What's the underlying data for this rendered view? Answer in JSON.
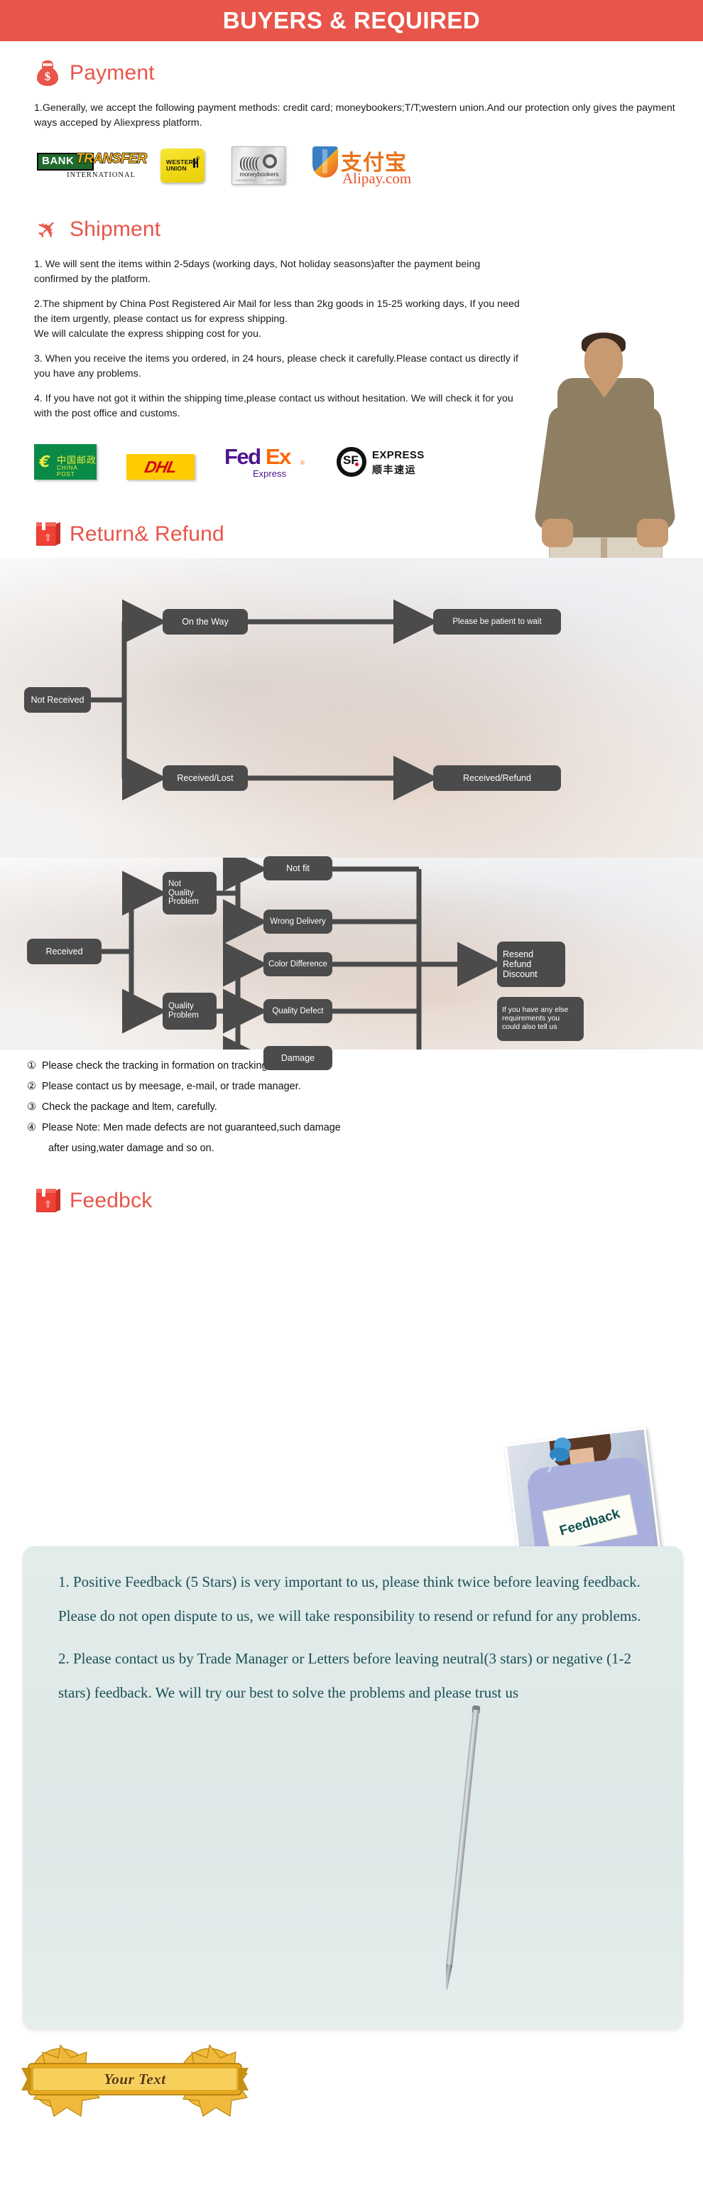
{
  "banner": {
    "title": "BUYERS & REQUIRED"
  },
  "payment": {
    "heading": "Payment",
    "icon": "money-bag-icon",
    "paragraph": "1.Generally, we accept the following payment methods: credit card; moneybookers;T/T;western union.And our protection only gives the payment ways acceped by Aliexpress platform.",
    "logos": [
      {
        "name": "bank-transfer-logo",
        "primary": "BANK",
        "secondary": "TRANSFER",
        "tertiary": "INTERNATIONAL"
      },
      {
        "name": "western-union-logo",
        "line1": "WESTERN",
        "line2": "UNION"
      },
      {
        "name": "moneybookers-logo",
        "label": "moneybookers",
        "fine_left": "moneybookers",
        "fine_right": "3456 8793"
      },
      {
        "name": "alipay-logo",
        "cn": "支付宝",
        "en": "Alipay.com"
      }
    ]
  },
  "shipment": {
    "heading": "Shipment",
    "icon": "airplane-icon",
    "paragraphs": [
      "1. We will sent the items within 2-5days (working days, Not holiday seasons)after the payment being confirmed by the platform.",
      "2.The shipment by China Post Registered Air Mail for less than  2kg goods in 15-25 working days, If  you need the item urgently, please contact us for express shipping.\nWe will calculate the express shipping cost for you.",
      "3. When you receive the items you ordered, in 24 hours, please check it carefully.Please contact us directly if you have any problems.",
      "4. If you have not got it within the shipping time,please contact us without hesitation. We will check it for you with the post office and customs."
    ],
    "carriers": [
      {
        "name": "china-post-logo",
        "cn": "中国邮政",
        "en": "CHINA POST"
      },
      {
        "name": "dhl-logo",
        "text": "DHL"
      },
      {
        "name": "fedex-logo",
        "part1": "Fed",
        "part2": "Ex",
        "sub": "Express",
        "reg": "®"
      },
      {
        "name": "sf-express-logo",
        "mark": "SF",
        "en": "EXPRESS",
        "cn": "顺丰速运"
      }
    ]
  },
  "returns": {
    "heading": "Return& Refund",
    "icon": "package-box-icon",
    "flow": {
      "not_received": "Not Received",
      "on_the_way": "On the Way",
      "be_patient": "Please be patient to wait",
      "received_lost": "Received/Lost",
      "received_refund": "Received/Refund",
      "received": "Received",
      "not_quality_problem": "Not\nQuality\nProblem",
      "quality_problem": "Quality\nProblem",
      "not_fit": "Not fit",
      "wrong_delivery": "Wrong Delivery",
      "color_difference": "Color Difference",
      "quality_defect": "Quality Defect",
      "damage": "Damage",
      "resend_refund_discount": "Resend\nRefund\nDiscount",
      "callout": "If you have any else\nrequirements you\ncould also tell us"
    },
    "notes": [
      {
        "marker": "①",
        "text": "Please check the tracking in formation on tracking website."
      },
      {
        "marker": "②",
        "text": "Please contact us by meesage, e-mail, or trade manager."
      },
      {
        "marker": "③",
        "text": "Check the package and ltem, carefully."
      },
      {
        "marker": "④",
        "text": "Please Note: Men made defects  are not guaranteed,such damage",
        "continuation": "after using,water damage and so on."
      }
    ]
  },
  "feedback": {
    "heading": "Feedbck",
    "icon": "package-box-icon",
    "photo_sign_text": "Feedback",
    "paragraphs": [
      "1. Positive Feedback (5 Stars) is very important to us, please think twice before leaving feedback. Please do not open dispute to us,   we will take responsibility to resend or refund for any problems.",
      "2. Please contact us by Trade Manager or Letters before leaving neutral(3 stars) or negative (1-2 stars) feedback. We will try our best to solve the problems and please trust us"
    ]
  },
  "gold_banner": {
    "text": "Your Text"
  },
  "colors": {
    "accent_red": "#e8554a",
    "flow_box": "#4b4b4b",
    "feedback_panel": "#e2ecea",
    "feedback_text": "#1b4f56",
    "gold": "#e8b325"
  }
}
